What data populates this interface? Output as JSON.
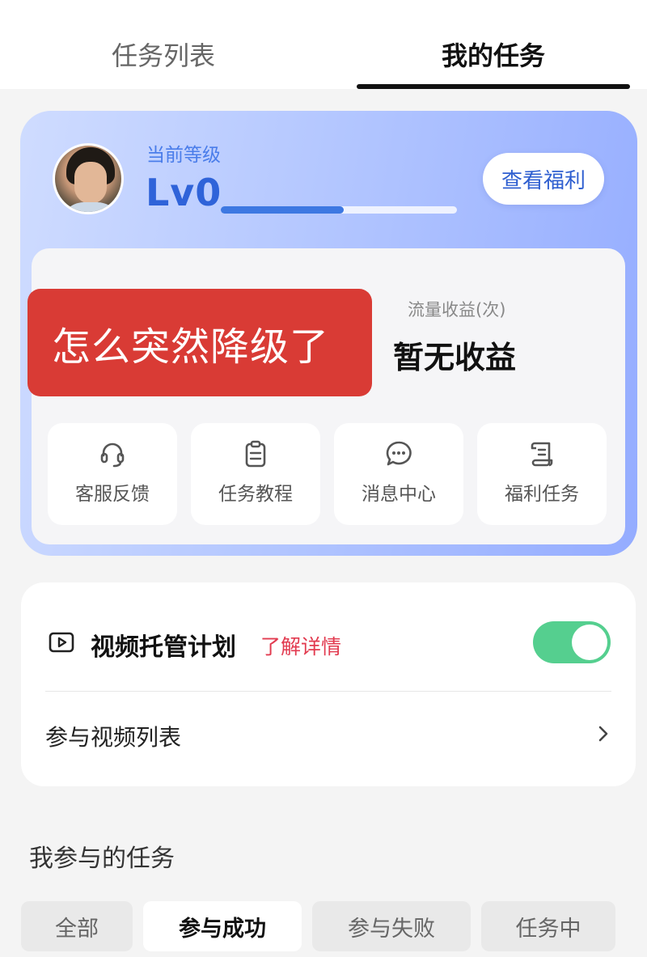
{
  "tabs": [
    {
      "label": "任务列表",
      "active": false
    },
    {
      "label": "我的任务",
      "active": true
    }
  ],
  "level": {
    "caption": "当前等级",
    "value": "Lv0",
    "progress": 0.52,
    "benefit_button": "查看福利"
  },
  "income": {
    "label": "流量收益(次)",
    "value": "暂无收益"
  },
  "overlay_text": "怎么突然降级了",
  "tools": [
    {
      "label": "客服反馈",
      "icon": "headset-icon"
    },
    {
      "label": "任务教程",
      "icon": "clipboard-icon"
    },
    {
      "label": "消息中心",
      "icon": "chat-bubble-icon"
    },
    {
      "label": "福利任务",
      "icon": "scroll-icon"
    }
  ],
  "plan": {
    "icon": "video-play-icon",
    "title": "视频托管计划",
    "link": "了解详情",
    "enabled": true
  },
  "video_list": {
    "label": "参与视频列表",
    "icon": "chevron-right-icon"
  },
  "my_tasks": {
    "title": "我参与的任务",
    "filters": [
      {
        "label": "全部",
        "active": false
      },
      {
        "label": "参与成功",
        "active": true
      },
      {
        "label": "参与失败",
        "active": false
      },
      {
        "label": "任务中",
        "active": false
      }
    ]
  },
  "colors": {
    "accent_blue": "#2f63d9",
    "toggle_green": "#55cf8f",
    "link_red": "#e23b50",
    "overlay_red": "#d93b35"
  }
}
